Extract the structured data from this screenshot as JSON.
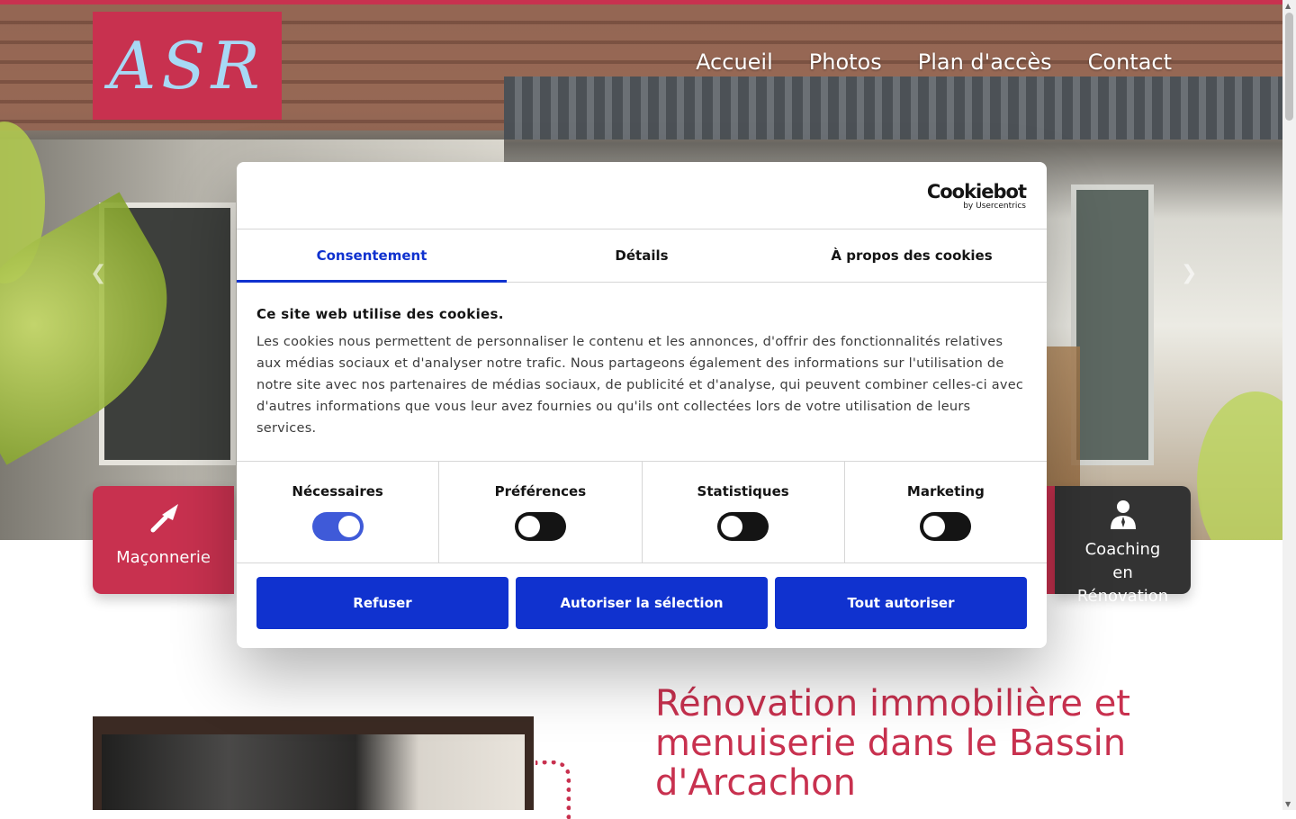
{
  "site": {
    "logo_text": "ASR",
    "nav": [
      "Accueil",
      "Photos",
      "Plan d'accès",
      "Contact"
    ]
  },
  "services": {
    "left": {
      "icon": "trowel-icon",
      "label": "Maçonnerie"
    },
    "right": {
      "icon": "person-icon",
      "label_lines": [
        "Coaching",
        "en",
        "Rénovation"
      ]
    }
  },
  "main": {
    "headline": "Rénovation immobilière et menuiserie dans le Bassin d'Arcachon"
  },
  "cookie": {
    "brand": "Cookiebot",
    "brand_sub": "by Usercentrics",
    "tabs": [
      "Consentement",
      "Détails",
      "À propos des cookies"
    ],
    "active_tab": 0,
    "title": "Ce site web utilise des cookies.",
    "text": "Les cookies nous permettent de personnaliser le contenu et les annonces, d'offrir des fonctionnalités relatives aux médias sociaux et d'analyser notre trafic. Nous partageons également des informations sur l'utilisation de notre site avec nos partenaires de médias sociaux, de publicité et d'analyse, qui peuvent combiner celles-ci avec d'autres informations que vous leur avez fournies ou qu'ils ont collectées lors de votre utilisation de leurs services.",
    "toggles": [
      {
        "label": "Nécessaires",
        "on": true
      },
      {
        "label": "Préférences",
        "on": false
      },
      {
        "label": "Statistiques",
        "on": false
      },
      {
        "label": "Marketing",
        "on": false
      }
    ],
    "buttons": [
      "Refuser",
      "Autoriser la sélection",
      "Tout autoriser"
    ]
  },
  "colors": {
    "brand": "#c8314f",
    "logo_text": "#a7d9f5",
    "cookie_accent": "#1032cf",
    "dark_tile": "#333333"
  }
}
